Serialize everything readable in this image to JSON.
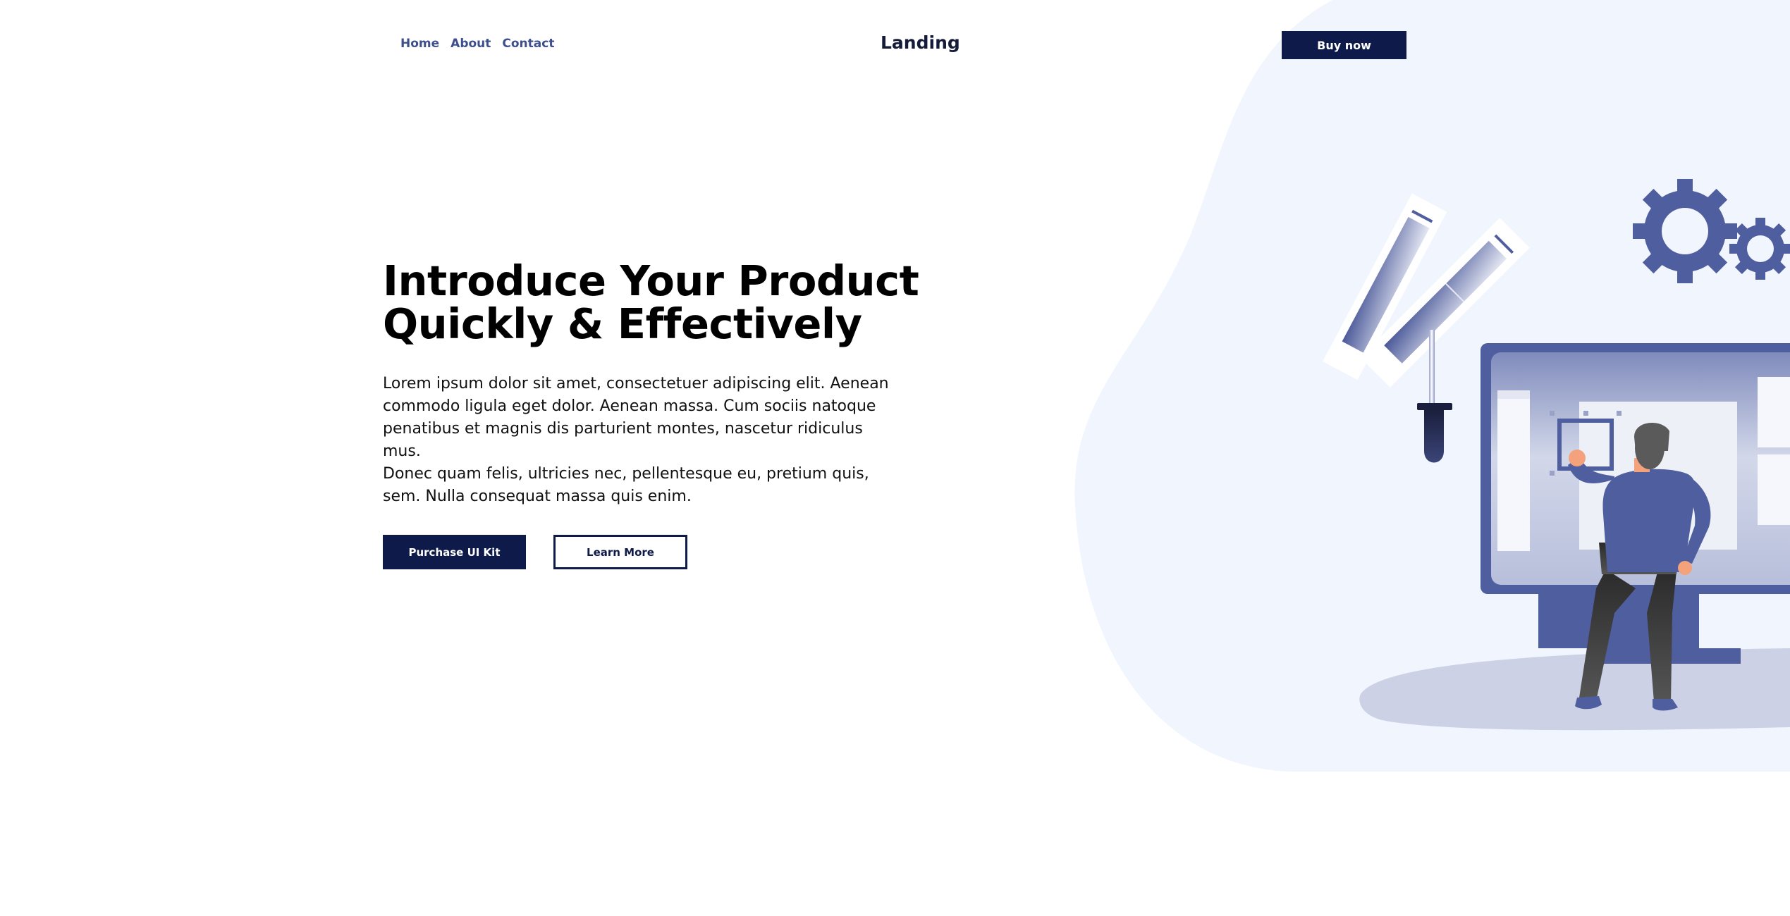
{
  "nav": {
    "links": [
      "Home",
      "About",
      "Contact"
    ]
  },
  "brand": "Landing",
  "header": {
    "cta_label": "Buy now"
  },
  "hero": {
    "headline_line1": "Introduce Your Product",
    "headline_line2": "Quickly & Effectively",
    "paragraph1": "Lorem ipsum dolor sit amet, consectetuer adipiscing elit. Aenean commodo ligula eget dolor. Aenean massa. Cum sociis natoque penatibus et magnis dis parturient montes, nascetur ridiculus mus.",
    "paragraph2": "Donec quam felis, ultricies nec, pellentesque eu, pretium quis, sem. Nulla consequat massa quis enim.",
    "primary_button": "Purchase UI Kit",
    "secondary_button": "Learn More"
  },
  "colors": {
    "navy": "#0e1a4a",
    "accent": "#4f5e9e",
    "blob": "#f1f5fd",
    "nav_link": "#3d4f8c"
  }
}
